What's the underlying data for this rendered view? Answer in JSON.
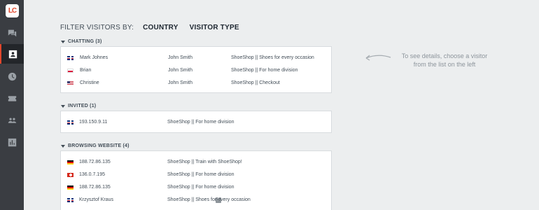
{
  "app": {
    "logo_text": "LC",
    "accent_color": "#e1462c"
  },
  "sidebar": {
    "items": [
      {
        "icon": "chats-icon"
      },
      {
        "icon": "visitors-icon",
        "active": true
      },
      {
        "icon": "history-icon"
      },
      {
        "icon": "tickets-icon"
      },
      {
        "icon": "agents-icon"
      },
      {
        "icon": "reports-icon"
      }
    ]
  },
  "filter": {
    "label": "FILTER VISITORS BY:",
    "options": [
      "COUNTRY",
      "VISITOR TYPE"
    ]
  },
  "sections": {
    "chatting": {
      "title": "CHATTING (3)",
      "rows": [
        {
          "flag": "uk",
          "name": "Mark Johnes",
          "agent": "John Smith",
          "page": "ShoeShop || Shoes for every occasion"
        },
        {
          "flag": "pl",
          "name": "Brian",
          "agent": "John Smith",
          "page": "ShoeShop || For home division"
        },
        {
          "flag": "us",
          "name": "Christine",
          "agent": "John Smith",
          "page": "ShoeShop || Checkout"
        }
      ]
    },
    "invited": {
      "title": "INVITED (1)",
      "rows": [
        {
          "flag": "uk",
          "name": "193.150.9.11",
          "page": "ShoeShop || For home division"
        }
      ]
    },
    "browsing": {
      "title": "BROWSING WEBSITE (4)",
      "rows": [
        {
          "flag": "de",
          "name": "188.72.86.135",
          "page": "ShoeShop || Train with ShoeShop!"
        },
        {
          "flag": "ch",
          "name": "136.0.7.195",
          "page": "ShoeShop || For home division"
        },
        {
          "flag": "de",
          "name": "188.72.86.135",
          "page": "ShoeShop || For home division"
        },
        {
          "flag": "uk",
          "name": "Krzysztof Kraus",
          "source": "f",
          "page": "ShoeShop || Shoes for every occasion"
        }
      ]
    }
  },
  "hint": {
    "line1": "To see details, choose a visitor",
    "line2": "from the list on the left"
  }
}
